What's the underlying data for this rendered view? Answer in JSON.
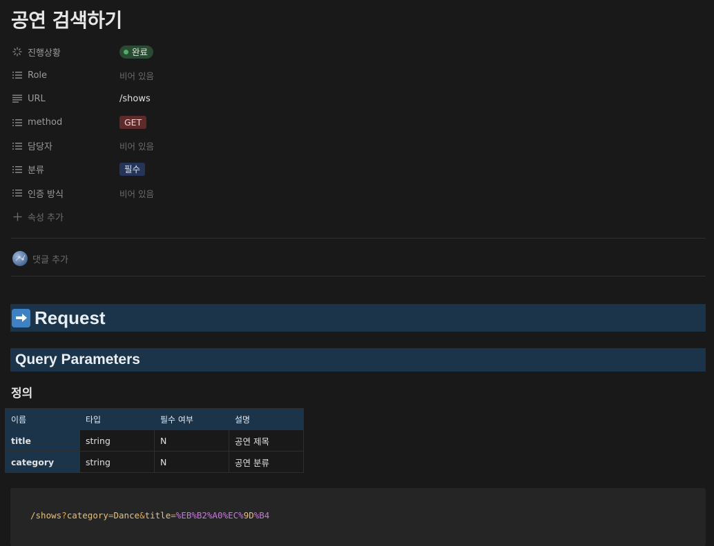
{
  "page": {
    "title": "공연 검색하기"
  },
  "properties": [
    {
      "label": "진행상황",
      "icon": "status-spinner-icon",
      "type": "status",
      "value": "완료"
    },
    {
      "label": "Role",
      "icon": "list-icon",
      "type": "empty",
      "value": "비어 있음"
    },
    {
      "label": "URL",
      "icon": "text-lines-icon",
      "type": "text",
      "value": "/shows"
    },
    {
      "label": "method",
      "icon": "list-icon",
      "type": "tag-get",
      "value": "GET"
    },
    {
      "label": "담당자",
      "icon": "list-icon",
      "type": "empty",
      "value": "비어 있음"
    },
    {
      "label": "분류",
      "icon": "list-icon",
      "type": "tag-required",
      "value": "필수"
    },
    {
      "label": "인증 방식",
      "icon": "list-icon",
      "type": "empty",
      "value": "비어 있음"
    }
  ],
  "add_property_label": "속성 추가",
  "comment": {
    "placeholder": "댓글 추가"
  },
  "request_heading": "Request",
  "query_heading": "Query Parameters",
  "definition_heading": "정의",
  "params_table": {
    "headers": [
      "이름",
      "타입",
      "필수 여부",
      "설명"
    ],
    "rows": [
      [
        "title",
        "string",
        "N",
        "공연 제목"
      ],
      [
        "category",
        "string",
        "N",
        "공연 분류"
      ]
    ]
  },
  "code": {
    "path": "/shows",
    "q": "?",
    "k1": "category",
    "eq1": "=",
    "v1": "Dance",
    "amp": "&",
    "k2": "title",
    "eq2": "=",
    "pct1": "%",
    "hex1": "EB",
    "pct2": "%",
    "hex2": "B2",
    "pct3": "%",
    "hex3": "A0",
    "pct4": "%",
    "hex4": "EC",
    "pct5": "%",
    "hex5": "9D",
    "pct6": "%",
    "hex6": "B4"
  },
  "colors": {
    "background": "#191919",
    "header_block": "#1b3449",
    "status_green": "#4caf6a",
    "get_tag": "#5e2a2a",
    "required_tag": "#25355a"
  }
}
